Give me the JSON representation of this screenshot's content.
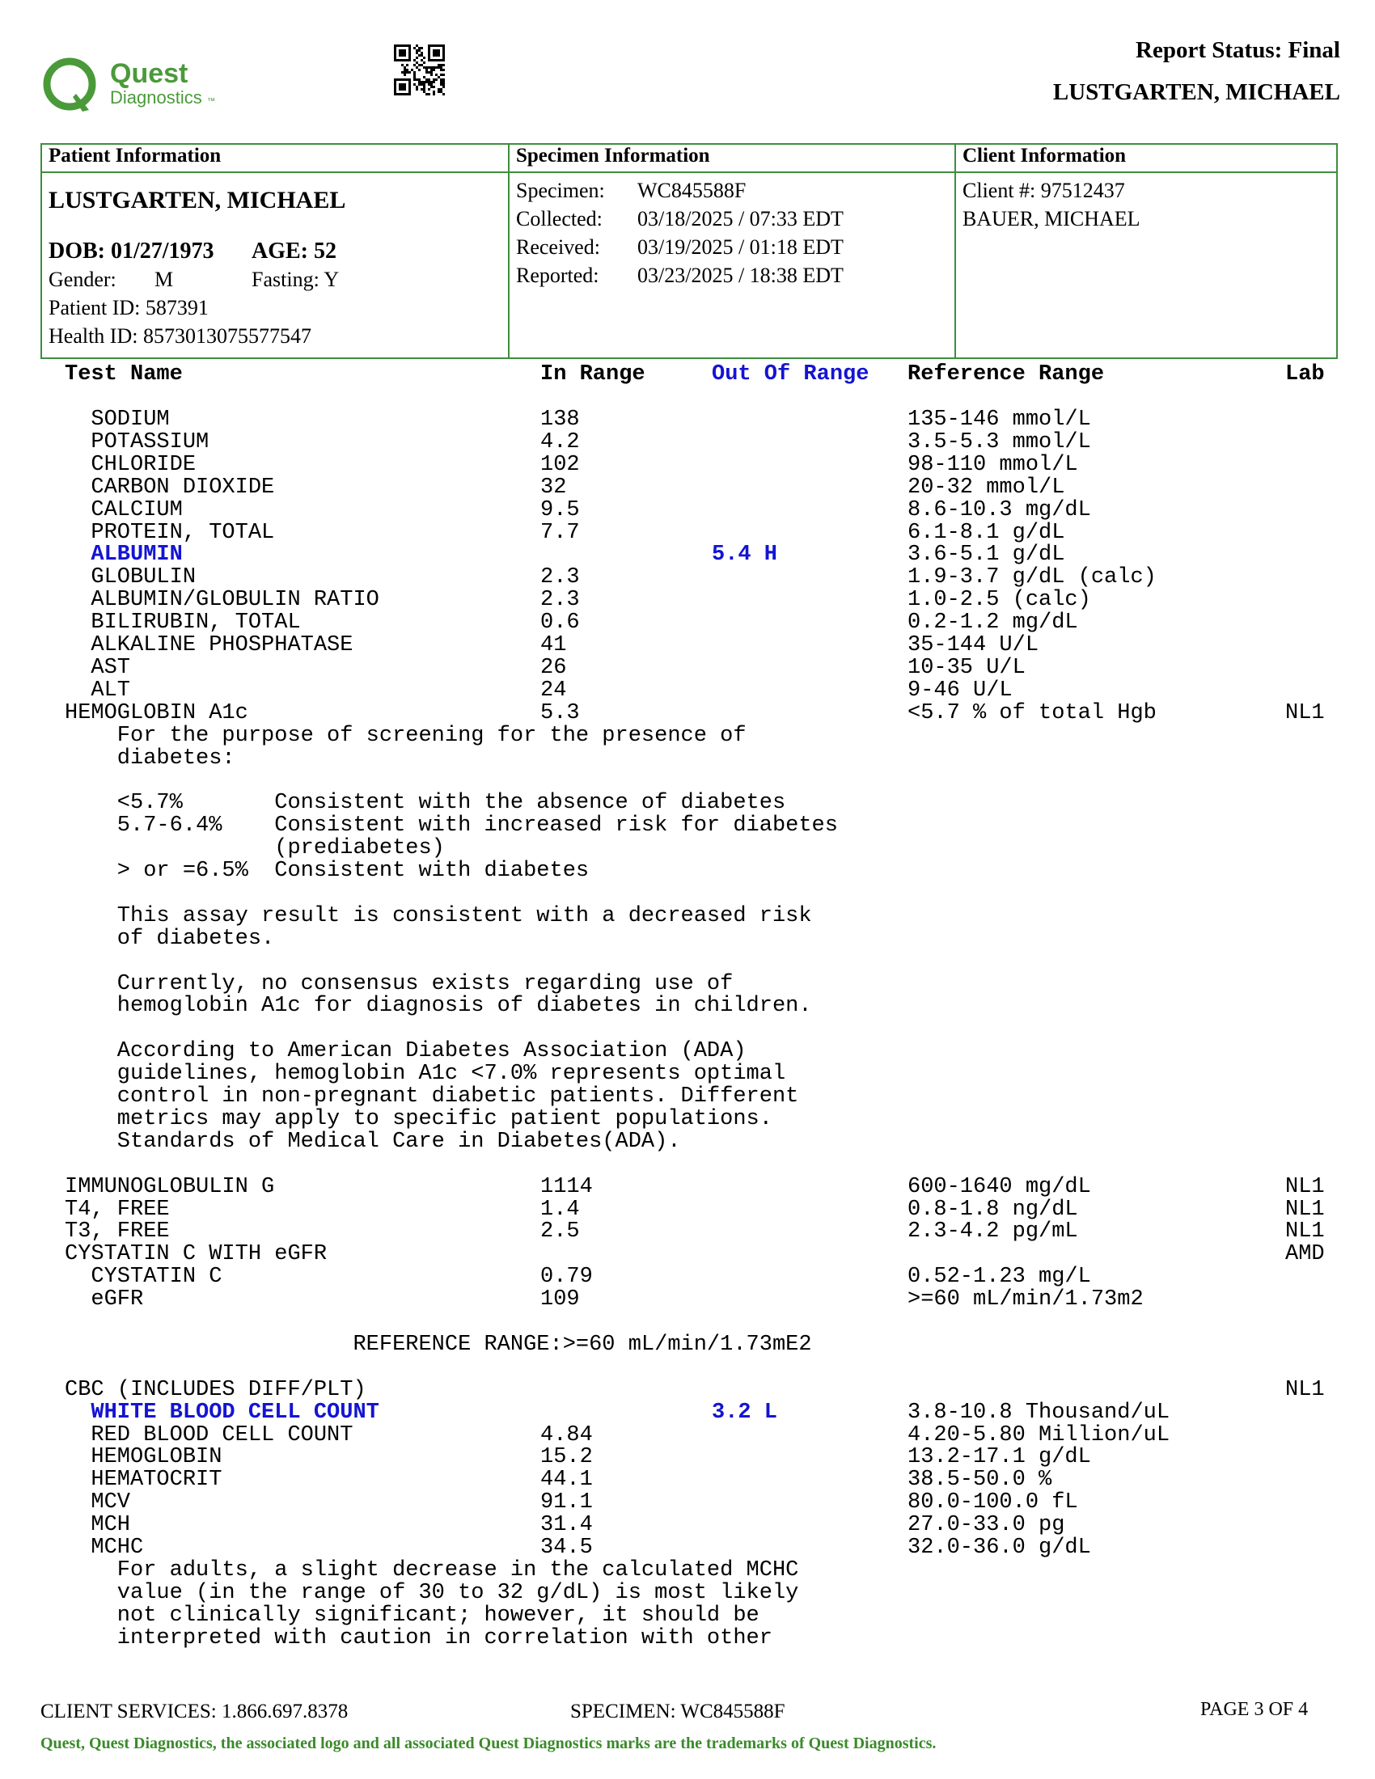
{
  "header": {
    "logo_word1": "Quest",
    "logo_word2": "Diagnostics",
    "logo_tm": "™",
    "report_status": "Report Status: Final",
    "patient_name": "LUSTGARTEN, MICHAEL",
    "brand_color": "#3e8e3e"
  },
  "info": {
    "patient_heading": "Patient Information",
    "specimen_heading": "Specimen Information",
    "client_heading": "Client Information",
    "patient_name": "LUSTGARTEN, MICHAEL",
    "dob": "DOB: 01/27/1973",
    "age": "AGE: 52",
    "gender_label": "Gender:",
    "gender": "M",
    "fasting": "Fasting: Y",
    "patient_id": "Patient ID: 587391",
    "health_id": "Health ID: 8573013075577547",
    "specimen_rows": [
      {
        "label": "Specimen:",
        "value": "WC845588F"
      },
      {
        "label": "Collected:",
        "value": "03/18/2025  / 07:33 EDT"
      },
      {
        "label": "Received:",
        "value": "03/19/2025  / 01:18 EDT"
      },
      {
        "label": "Reported:",
        "value": "03/23/2025  / 18:38 EDT"
      }
    ],
    "client_number": "Client #: 97512437",
    "client_name": "BAUER, MICHAEL"
  },
  "columns": {
    "test_name": "Test Name",
    "in_range": "In Range",
    "out_of_range": "Out Of Range",
    "reference_range": "Reference Range",
    "lab": "Lab"
  },
  "rows": [
    {
      "name": "  SODIUM",
      "in": "138",
      "out": "",
      "ref": "135-146 mmol/L",
      "lab": "",
      "flag": false
    },
    {
      "name": "  POTASSIUM",
      "in": "4.2",
      "out": "",
      "ref": "3.5-5.3 mmol/L",
      "lab": "",
      "flag": false
    },
    {
      "name": "  CHLORIDE",
      "in": "102",
      "out": "",
      "ref": "98-110 mmol/L",
      "lab": "",
      "flag": false
    },
    {
      "name": "  CARBON DIOXIDE",
      "in": "32",
      "out": "",
      "ref": "20-32 mmol/L",
      "lab": "",
      "flag": false
    },
    {
      "name": "  CALCIUM",
      "in": "9.5",
      "out": "",
      "ref": "8.6-10.3 mg/dL",
      "lab": "",
      "flag": false
    },
    {
      "name": "  PROTEIN, TOTAL",
      "in": "7.7",
      "out": "",
      "ref": "6.1-8.1 g/dL",
      "lab": "",
      "flag": false
    },
    {
      "name": "  ALBUMIN",
      "in": "",
      "out": "5.4 H",
      "ref": "3.6-5.1 g/dL",
      "lab": "",
      "flag": true
    },
    {
      "name": "  GLOBULIN",
      "in": "2.3",
      "out": "",
      "ref": "1.9-3.7 g/dL (calc)",
      "lab": "",
      "flag": false
    },
    {
      "name": "  ALBUMIN/GLOBULIN RATIO",
      "in": "2.3",
      "out": "",
      "ref": "1.0-2.5 (calc)",
      "lab": "",
      "flag": false
    },
    {
      "name": "  BILIRUBIN, TOTAL",
      "in": "0.6",
      "out": "",
      "ref": "0.2-1.2 mg/dL",
      "lab": "",
      "flag": false
    },
    {
      "name": "  ALKALINE PHOSPHATASE",
      "in": "41",
      "out": "",
      "ref": "35-144 U/L",
      "lab": "",
      "flag": false
    },
    {
      "name": "  AST",
      "in": "26",
      "out": "",
      "ref": "10-35 U/L",
      "lab": "",
      "flag": false
    },
    {
      "name": "  ALT",
      "in": "24",
      "out": "",
      "ref": "9-46 U/L",
      "lab": "",
      "flag": false
    },
    {
      "name": "HEMOGLOBIN A1c",
      "in": "5.3",
      "out": "",
      "ref": "<5.7 % of total Hgb",
      "lab": "NL1",
      "flag": false
    },
    {
      "name": "    For the purpose of screening for the presence of",
      "in": "",
      "out": "",
      "ref": "",
      "lab": "",
      "flag": false
    },
    {
      "name": "    diabetes:",
      "in": "",
      "out": "",
      "ref": "",
      "lab": "",
      "flag": false
    },
    {
      "name": "",
      "in": "",
      "out": "",
      "ref": "",
      "lab": "",
      "flag": false
    },
    {
      "name": "    <5.7%       Consistent with the absence of diabetes",
      "in": "",
      "out": "",
      "ref": "",
      "lab": "",
      "flag": false
    },
    {
      "name": "    5.7-6.4%    Consistent with increased risk for diabetes",
      "in": "",
      "out": "",
      "ref": "",
      "lab": "",
      "flag": false
    },
    {
      "name": "                (prediabetes)",
      "in": "",
      "out": "",
      "ref": "",
      "lab": "",
      "flag": false
    },
    {
      "name": "    > or =6.5%  Consistent with diabetes",
      "in": "",
      "out": "",
      "ref": "",
      "lab": "",
      "flag": false
    },
    {
      "name": "",
      "in": "",
      "out": "",
      "ref": "",
      "lab": "",
      "flag": false
    },
    {
      "name": "    This assay result is consistent with a decreased risk",
      "in": "",
      "out": "",
      "ref": "",
      "lab": "",
      "flag": false
    },
    {
      "name": "    of diabetes.",
      "in": "",
      "out": "",
      "ref": "",
      "lab": "",
      "flag": false
    },
    {
      "name": "",
      "in": "",
      "out": "",
      "ref": "",
      "lab": "",
      "flag": false
    },
    {
      "name": "    Currently, no consensus exists regarding use of",
      "in": "",
      "out": "",
      "ref": "",
      "lab": "",
      "flag": false
    },
    {
      "name": "    hemoglobin A1c for diagnosis of diabetes in children.",
      "in": "",
      "out": "",
      "ref": "",
      "lab": "",
      "flag": false
    },
    {
      "name": "",
      "in": "",
      "out": "",
      "ref": "",
      "lab": "",
      "flag": false
    },
    {
      "name": "    According to American Diabetes Association (ADA)",
      "in": "",
      "out": "",
      "ref": "",
      "lab": "",
      "flag": false
    },
    {
      "name": "    guidelines, hemoglobin A1c <7.0% represents optimal",
      "in": "",
      "out": "",
      "ref": "",
      "lab": "",
      "flag": false
    },
    {
      "name": "    control in non-pregnant diabetic patients. Different",
      "in": "",
      "out": "",
      "ref": "",
      "lab": "",
      "flag": false
    },
    {
      "name": "    metrics may apply to specific patient populations.",
      "in": "",
      "out": "",
      "ref": "",
      "lab": "",
      "flag": false
    },
    {
      "name": "    Standards of Medical Care in Diabetes(ADA).",
      "in": "",
      "out": "",
      "ref": "",
      "lab": "",
      "flag": false
    },
    {
      "name": "",
      "in": "",
      "out": "",
      "ref": "",
      "lab": "",
      "flag": false
    },
    {
      "name": "IMMUNOGLOBULIN G",
      "in": "1114",
      "out": "",
      "ref": "600-1640 mg/dL",
      "lab": "NL1",
      "flag": false
    },
    {
      "name": "T4, FREE",
      "in": "1.4",
      "out": "",
      "ref": "0.8-1.8 ng/dL",
      "lab": "NL1",
      "flag": false
    },
    {
      "name": "T3, FREE",
      "in": "2.5",
      "out": "",
      "ref": "2.3-4.2 pg/mL",
      "lab": "NL1",
      "flag": false
    },
    {
      "name": "CYSTATIN C WITH eGFR",
      "in": "",
      "out": "",
      "ref": "",
      "lab": "AMD",
      "flag": false
    },
    {
      "name": "  CYSTATIN C",
      "in": "0.79",
      "out": "",
      "ref": "0.52-1.23 mg/L",
      "lab": "",
      "flag": false
    },
    {
      "name": "  eGFR",
      "in": "109",
      "out": "",
      "ref": ">=60 mL/min/1.73m2",
      "lab": "",
      "flag": false
    },
    {
      "name": "",
      "in": "",
      "out": "",
      "ref": "",
      "lab": "",
      "flag": false
    },
    {
      "name": "                      REFERENCE RANGE:>=60 mL/min/1.73mE2",
      "in": "",
      "out": "",
      "ref": "",
      "lab": "",
      "flag": false
    },
    {
      "name": "",
      "in": "",
      "out": "",
      "ref": "",
      "lab": "",
      "flag": false
    },
    {
      "name": "CBC (INCLUDES DIFF/PLT)",
      "in": "",
      "out": "",
      "ref": "",
      "lab": "NL1",
      "flag": false
    },
    {
      "name": "  WHITE BLOOD CELL COUNT",
      "in": "",
      "out": "3.2 L",
      "ref": "3.8-10.8 Thousand/uL",
      "lab": "",
      "flag": true
    },
    {
      "name": "  RED BLOOD CELL COUNT",
      "in": "4.84",
      "out": "",
      "ref": "4.20-5.80 Million/uL",
      "lab": "",
      "flag": false
    },
    {
      "name": "  HEMOGLOBIN",
      "in": "15.2",
      "out": "",
      "ref": "13.2-17.1 g/dL",
      "lab": "",
      "flag": false
    },
    {
      "name": "  HEMATOCRIT",
      "in": "44.1",
      "out": "",
      "ref": "38.5-50.0 %",
      "lab": "",
      "flag": false
    },
    {
      "name": "  MCV",
      "in": "91.1",
      "out": "",
      "ref": "80.0-100.0 fL",
      "lab": "",
      "flag": false
    },
    {
      "name": "  MCH",
      "in": "31.4",
      "out": "",
      "ref": "27.0-33.0 pg",
      "lab": "",
      "flag": false
    },
    {
      "name": "  MCHC",
      "in": "34.5",
      "out": "",
      "ref": "32.0-36.0 g/dL",
      "lab": "",
      "flag": false
    },
    {
      "name": "    For adults, a slight decrease in the calculated MCHC",
      "in": "",
      "out": "",
      "ref": "",
      "lab": "",
      "flag": false
    },
    {
      "name": "    value (in the range of 30 to 32 g/dL) is most likely",
      "in": "",
      "out": "",
      "ref": "",
      "lab": "",
      "flag": false
    },
    {
      "name": "    not clinically significant; however, it should be",
      "in": "",
      "out": "",
      "ref": "",
      "lab": "",
      "flag": false
    },
    {
      "name": "    interpreted with caution in correlation with other",
      "in": "",
      "out": "",
      "ref": "",
      "lab": "",
      "flag": false
    }
  ],
  "footer": {
    "client_services": "CLIENT SERVICES: 1.866.697.8378",
    "specimen": "SPECIMEN: WC845588F",
    "page": "PAGE 3 OF 4",
    "trademark": "Quest, Quest Diagnostics, the associated logo and all associated Quest Diagnostics marks are the trademarks of Quest Diagnostics."
  }
}
